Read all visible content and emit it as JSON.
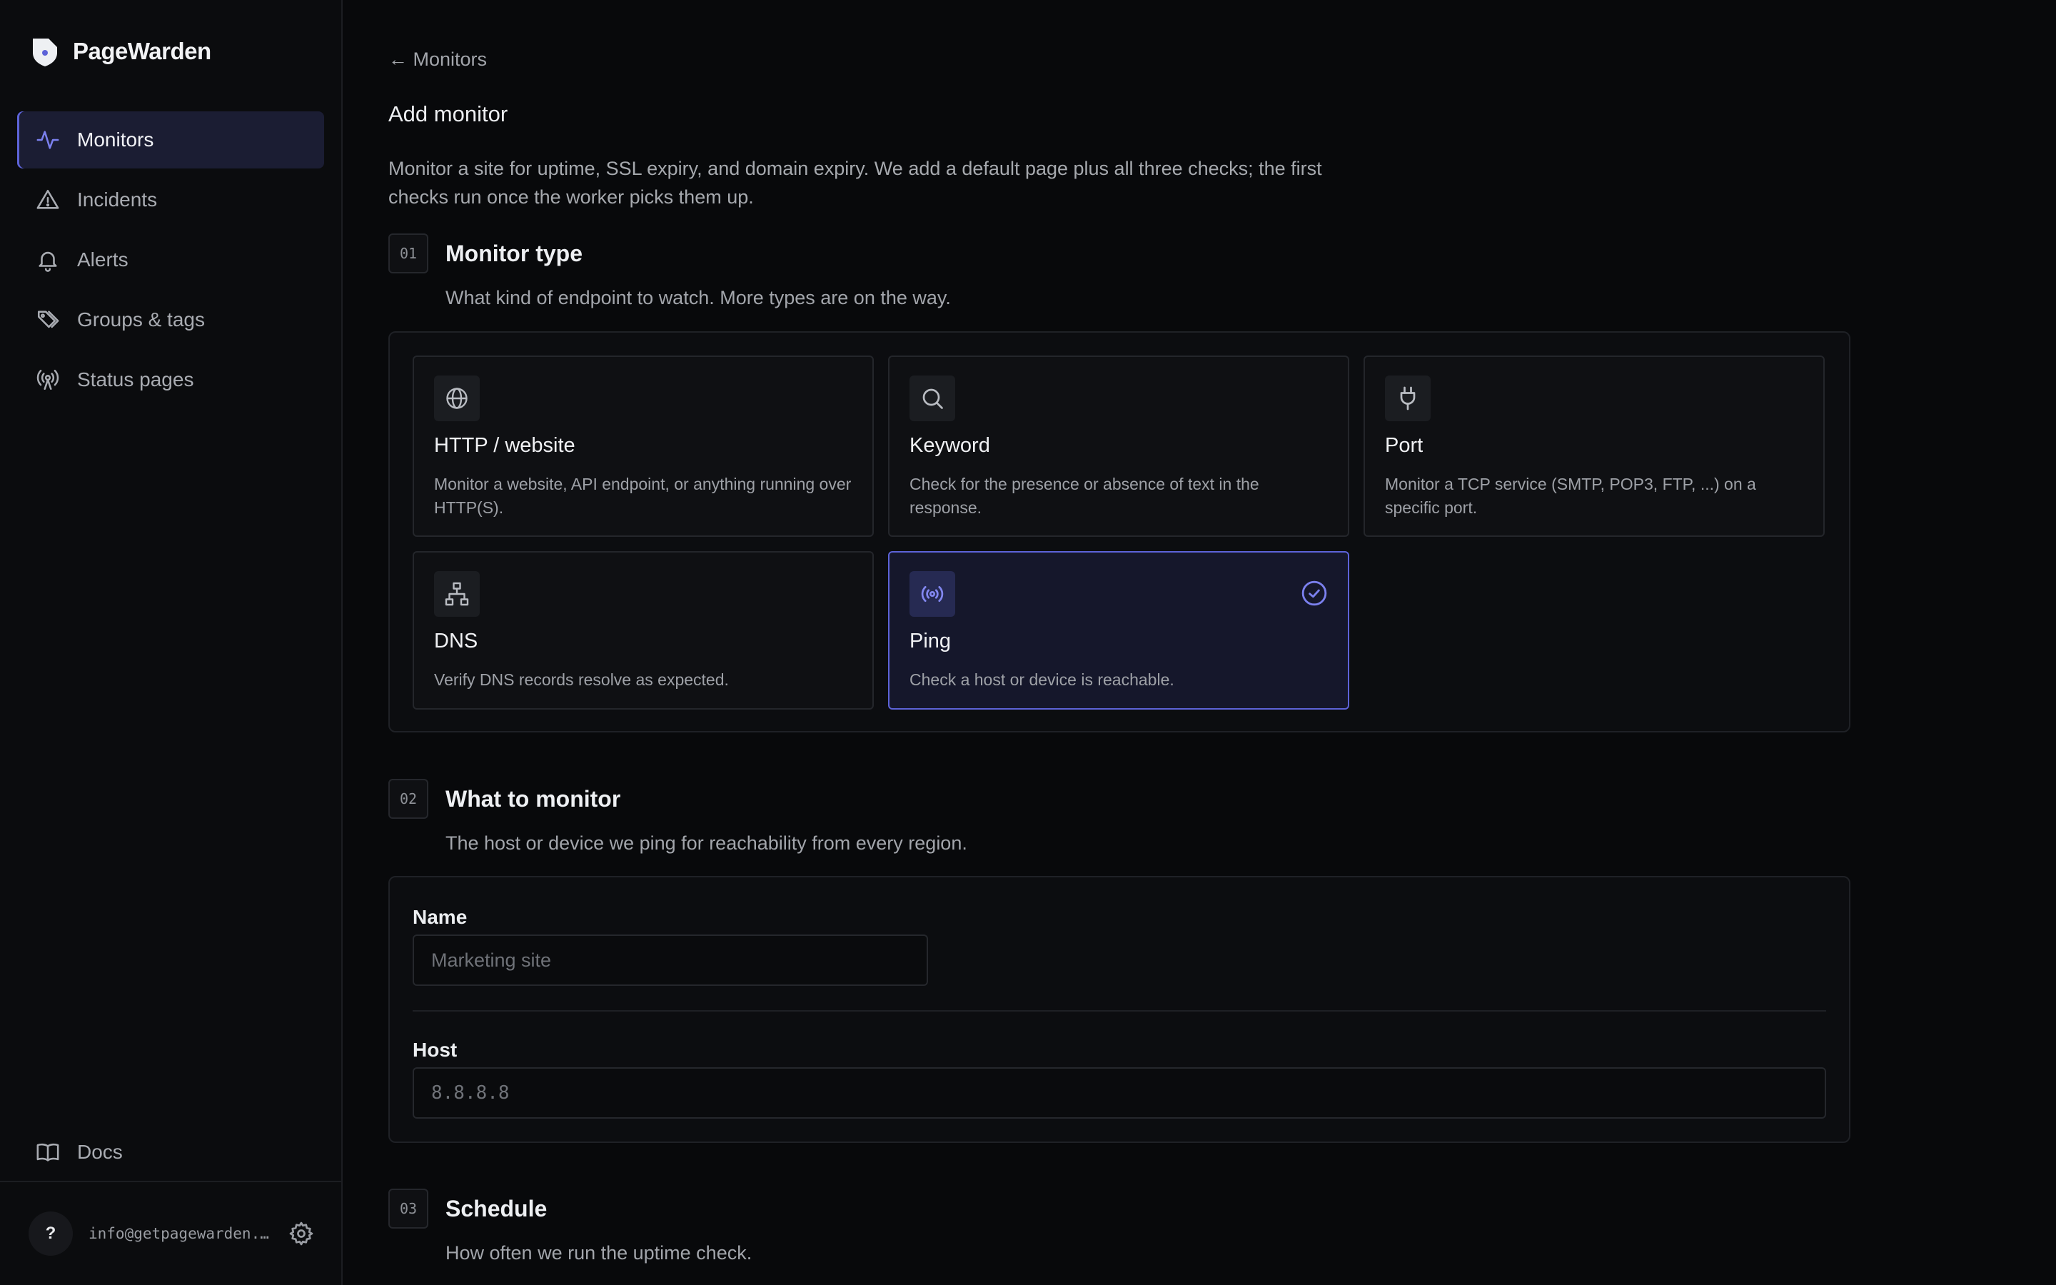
{
  "brand": {
    "name": "PageWarden",
    "logo_icon": "shield-logo-icon"
  },
  "sidebar": {
    "items": [
      {
        "label": "Monitors",
        "icon": "activity-icon",
        "active": true
      },
      {
        "label": "Incidents",
        "icon": "warning-triangle-icon",
        "active": false
      },
      {
        "label": "Alerts",
        "icon": "bell-icon",
        "active": false
      },
      {
        "label": "Groups & tags",
        "icon": "tags-icon",
        "active": false
      },
      {
        "label": "Status pages",
        "icon": "broadcast-icon",
        "active": false
      }
    ],
    "docs_label": "Docs",
    "user": {
      "avatar_text": "?",
      "email": "info@getpagewarden.com"
    }
  },
  "header": {
    "back_label": "← Monitors",
    "title": "Add monitor",
    "description": "Monitor a site for uptime, SSL expiry, and domain expiry. We add a default page plus all three checks; the first checks run once the worker picks them up."
  },
  "sections": [
    {
      "num": "01",
      "title": "Monitor type",
      "subtitle": "What kind of endpoint to watch. More types are on the way."
    },
    {
      "num": "02",
      "title": "What to monitor",
      "subtitle": "The host or device we ping for reachability from every region."
    },
    {
      "num": "03",
      "title": "Schedule",
      "subtitle": "How often we run the uptime check."
    }
  ],
  "monitor_types": [
    {
      "title": "HTTP / website",
      "desc": "Monitor a website, API endpoint, or anything running over HTTP(S).",
      "icon": "globe-icon",
      "selected": false
    },
    {
      "title": "Keyword",
      "desc": "Check for the presence or absence of text in the response.",
      "icon": "search-icon",
      "selected": false
    },
    {
      "title": "Port",
      "desc": "Monitor a TCP service (SMTP, POP3, FTP, ...) on a specific port.",
      "icon": "plug-icon",
      "selected": false
    },
    {
      "title": "DNS",
      "desc": "Verify DNS records resolve as expected.",
      "icon": "network-icon",
      "selected": false
    },
    {
      "title": "Ping",
      "desc": "Check a host or device is reachable.",
      "icon": "broadcast-icon",
      "selected": true
    }
  ],
  "form": {
    "name_label": "Name",
    "name_value": "",
    "name_placeholder": "Marketing site",
    "host_label": "Host",
    "host_value": "",
    "host_placeholder": "8.8.8.8"
  },
  "colors": {
    "accent": "#5d63d8",
    "background": "#08090b",
    "sidebar": "#0b0c0e",
    "selected_card": "#15172b"
  }
}
